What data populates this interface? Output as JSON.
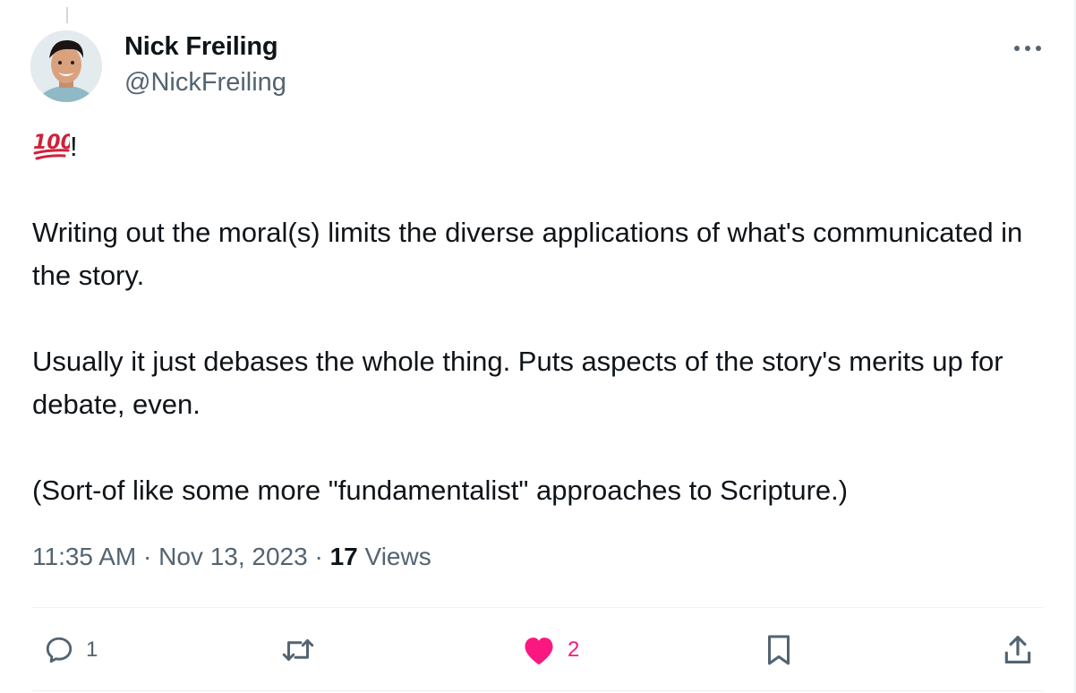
{
  "author": {
    "display_name": "Nick Freiling",
    "handle": "@NickFreiling"
  },
  "tweet": {
    "emoji_suffix": "!",
    "paragraphs": [
      "Writing out the moral(s) limits the diverse applications of what's communicated in the story.",
      "Usually it just debases the whole thing. Puts aspects of the story's merits up for debate, even.",
      "(Sort-of like some more \"fundamentalist\" approaches to Scripture.)"
    ]
  },
  "meta": {
    "time": "11:35 AM",
    "separator": "·",
    "date": "Nov 13, 2023",
    "views_count": "17",
    "views_label": "Views"
  },
  "actions": {
    "reply_count": "1",
    "like_count": "2"
  },
  "icons": {
    "emoji": "hundred-points-icon",
    "more": "more-dots-icon",
    "reply": "reply-icon",
    "retweet": "retweet-icon",
    "like": "heart-icon",
    "bookmark": "bookmark-icon",
    "share": "share-icon"
  },
  "colors": {
    "text_primary": "#0f1419",
    "text_secondary": "#536471",
    "like_pink": "#f91880",
    "divider": "#eff3f4",
    "emoji_red": "#d0213a"
  }
}
